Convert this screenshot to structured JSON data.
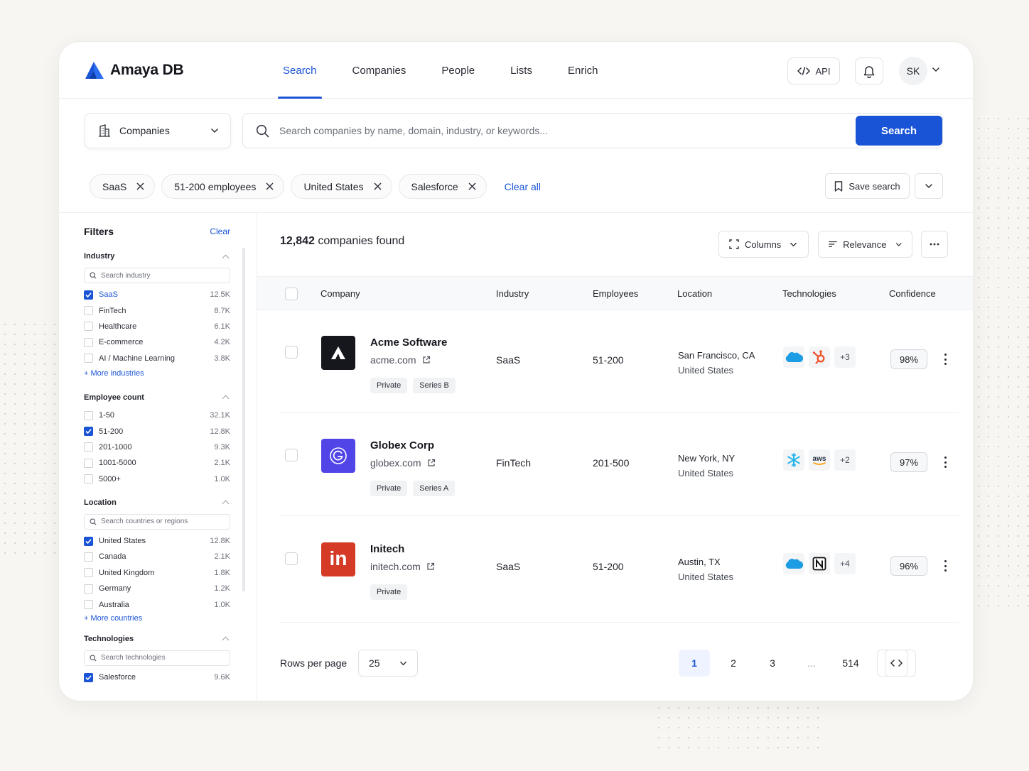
{
  "app": {
    "name": "Amaya DB",
    "brand_color": "#1a54d6"
  },
  "nav": {
    "items": [
      {
        "label": "Search",
        "active": true
      },
      {
        "label": "Companies"
      },
      {
        "label": "People"
      },
      {
        "label": "Lists"
      },
      {
        "label": "Enrich"
      }
    ]
  },
  "header": {
    "api_label": "API",
    "user_initials": "SK"
  },
  "search": {
    "entity": "Companies",
    "placeholder": "Search companies by name, domain, industry, or keywords...",
    "button": "Search"
  },
  "chips": {
    "items": [
      "SaaS",
      "51-200 employees",
      "United States",
      "Salesforce"
    ],
    "clear_all": "Clear all",
    "save_search": "Save search"
  },
  "filters": {
    "title": "Filters",
    "clear": "Clear",
    "industry": {
      "title": "Industry",
      "placeholder": "Search industry",
      "options": [
        {
          "label": "SaaS",
          "count": "12.5K",
          "checked": true
        },
        {
          "label": "FinTech",
          "count": "8.7K"
        },
        {
          "label": "Healthcare",
          "count": "6.1K"
        },
        {
          "label": "E-commerce",
          "count": "4.2K"
        },
        {
          "label": "AI / Machine Learning",
          "count": "3.8K"
        }
      ],
      "more": "+ More industries"
    },
    "employees": {
      "title": "Employee count",
      "options": [
        {
          "label": "1-50",
          "count": "32.1K"
        },
        {
          "label": "51-200",
          "count": "12.8K",
          "checked": true
        },
        {
          "label": "201-1000",
          "count": "9.3K"
        },
        {
          "label": "1001-5000",
          "count": "2.1K"
        },
        {
          "label": "5000+",
          "count": "1.0K"
        }
      ]
    },
    "location": {
      "title": "Location",
      "placeholder": "Search countries or regions",
      "options": [
        {
          "label": "United States",
          "count": "12.8K",
          "checked": true
        },
        {
          "label": "Canada",
          "count": "2.1K"
        },
        {
          "label": "United Kingdom",
          "count": "1.8K"
        },
        {
          "label": "Germany",
          "count": "1.2K"
        },
        {
          "label": "Australia",
          "count": "1.0K"
        }
      ],
      "more": "+ More countries"
    },
    "technologies": {
      "title": "Technologies",
      "placeholder": "Search technologies",
      "options": [
        {
          "label": "Salesforce",
          "count": "9.6K",
          "checked": true
        }
      ]
    }
  },
  "results": {
    "count": "12,842",
    "count_suffix": "companies found",
    "columns_label": "Columns",
    "sort_label": "Relevance"
  },
  "table": {
    "headers": {
      "company": "Company",
      "industry": "Industry",
      "employees": "Employees",
      "location": "Location",
      "technologies": "Technologies",
      "confidence": "Confidence"
    },
    "rows": [
      {
        "name": "Acme Software",
        "domain": "acme.com",
        "tags": [
          "Private",
          "Series B"
        ],
        "industry": "SaaS",
        "employees": "51-200",
        "city": "San Francisco, CA",
        "country": "United States",
        "techs": [
          "salesforce-icon",
          "hubspot-icon"
        ],
        "tech_more": "+3",
        "confidence": "98%",
        "logo_color": "#15171d"
      },
      {
        "name": "Globex Corp",
        "domain": "globex.com",
        "tags": [
          "Private",
          "Series A"
        ],
        "industry": "FinTech",
        "employees": "201-500",
        "city": "New York, NY",
        "country": "United States",
        "techs": [
          "snowflake-icon",
          "aws-icon"
        ],
        "tech_more": "+2",
        "confidence": "97%",
        "logo_color": "#5145e8"
      },
      {
        "name": "Initech",
        "domain": "initech.com",
        "tags": [
          "Private"
        ],
        "industry": "SaaS",
        "employees": "51-200",
        "city": "Austin, TX",
        "country": "United States",
        "techs": [
          "salesforce-icon",
          "notion-icon"
        ],
        "tech_more": "+4",
        "confidence": "96%",
        "logo_color": "#d53a26",
        "logo_text": "in"
      }
    ]
  },
  "pagination": {
    "rows_label": "Rows per page",
    "rows_value": "25",
    "pages": [
      "1",
      "2",
      "3",
      "...",
      "514"
    ],
    "current": "1"
  }
}
